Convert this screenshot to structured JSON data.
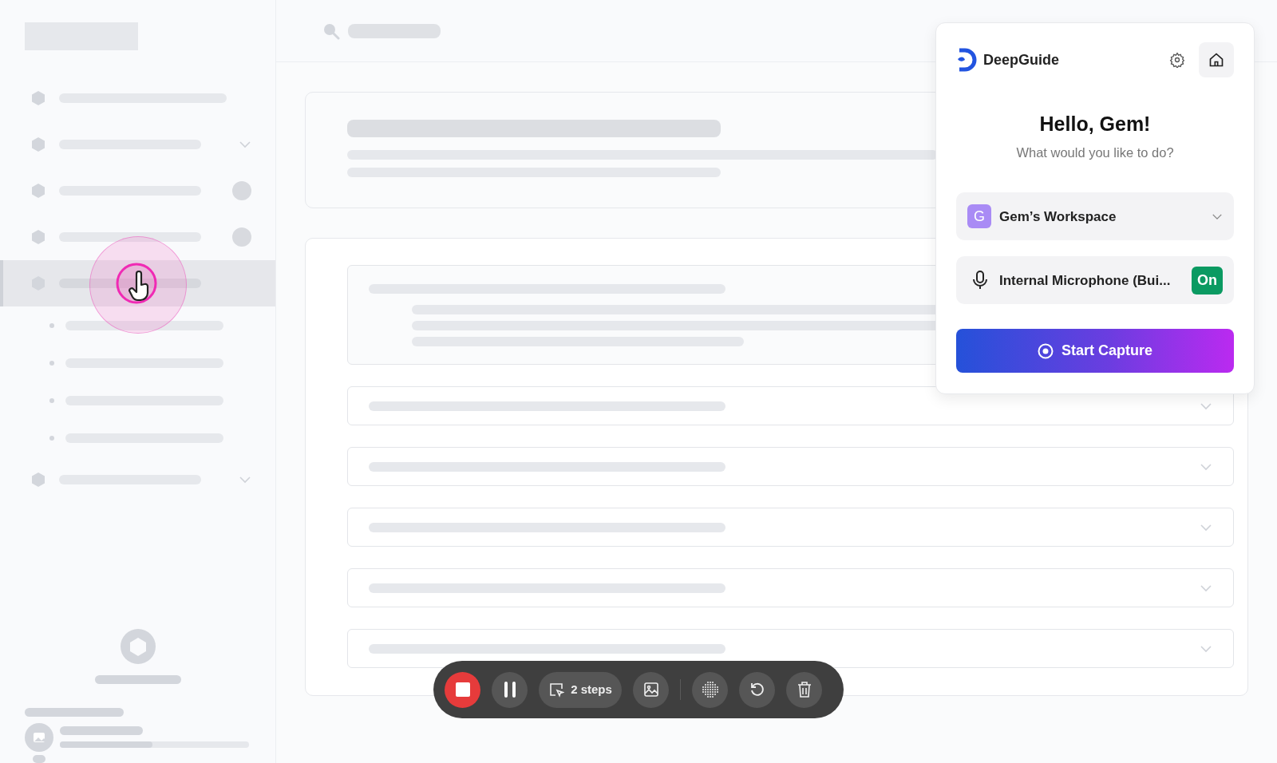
{
  "sidebar": {
    "items": [
      {
        "kind": "plain",
        "selected": false
      },
      {
        "kind": "dropdown",
        "selected": false
      },
      {
        "kind": "badge",
        "selected": false
      },
      {
        "kind": "badge",
        "selected": false
      },
      {
        "kind": "plain",
        "selected": true,
        "children": [
          {
            "kind": "bullet"
          },
          {
            "kind": "bullet"
          },
          {
            "kind": "bullet"
          },
          {
            "kind": "bullet"
          }
        ]
      },
      {
        "kind": "dropdown",
        "selected": false
      }
    ]
  },
  "content": {
    "rows": [
      {
        "expanded": true
      },
      {
        "expanded": false
      },
      {
        "expanded": false
      },
      {
        "expanded": false
      },
      {
        "expanded": false
      },
      {
        "expanded": false
      }
    ]
  },
  "panel": {
    "brand": "DeepGuide",
    "greeting": "Hello, Gem!",
    "subtitle": "What would you like to do?",
    "workspace": {
      "initial": "G",
      "name": "Gem’s Workspace"
    },
    "microphone": {
      "label": "Internal Microphone (Bui...",
      "on": true,
      "status": "On"
    },
    "start_button": "Start Capture"
  },
  "toolbar": {
    "steps": "2 steps"
  }
}
